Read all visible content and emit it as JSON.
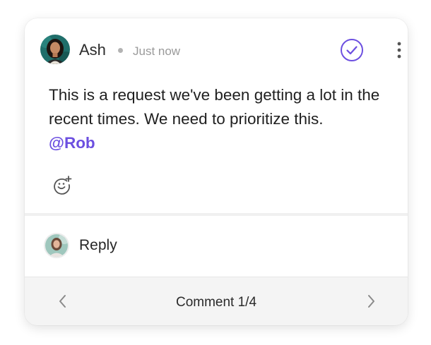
{
  "comment": {
    "author": "Ash",
    "timestamp": "Just now",
    "text": "This is a request we've been getting a lot in the recent times. We need to prioritize this.",
    "mention": "@Rob",
    "avatar_icon": "user-avatar-photo",
    "resolve_icon": "check-circle-icon",
    "more_icon": "more-vertical-icon",
    "reaction_icon": "add-reaction-icon"
  },
  "reply": {
    "label": "Reply",
    "avatar_icon": "current-user-avatar"
  },
  "navigation": {
    "counter": "Comment 1/4",
    "prev_icon": "chevron-left-icon",
    "next_icon": "chevron-right-icon"
  },
  "colors": {
    "accent": "#6c4fe0",
    "muted": "#9a9a9a",
    "footer_bg": "#f4f4f4"
  }
}
